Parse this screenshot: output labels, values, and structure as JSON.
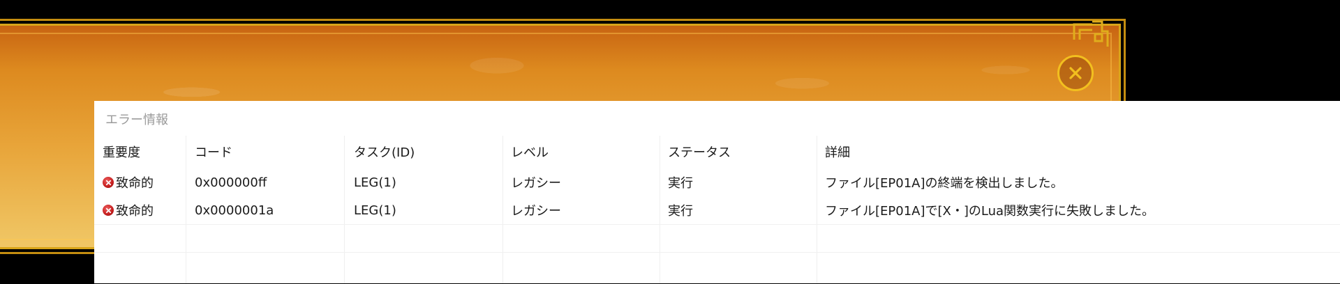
{
  "panel": {
    "title": "エラー情報"
  },
  "columns": [
    "重要度",
    "コード",
    "タスク(ID)",
    "レベル",
    "ステータス",
    "詳細"
  ],
  "rows": [
    {
      "severity": "致命的",
      "severity_icon": "error-x-icon",
      "code": "0x000000ff",
      "task": "LEG(1)",
      "level": "レガシー",
      "status": "実行",
      "detail": "ファイル[EP01A]の終端を検出しました。"
    },
    {
      "severity": "致命的",
      "severity_icon": "error-x-icon",
      "code": "0x0000001a",
      "task": "LEG(1)",
      "level": "レガシー",
      "status": "実行",
      "detail": "ファイル[EP01A]で[X・]のLua関数実行に失敗しました。"
    }
  ],
  "colors": {
    "frame_gold": "#d9a51a",
    "background_orange": "#dd8a1f",
    "error_red": "#c41e1e"
  },
  "icons": {
    "close": "close-circle-icon",
    "ornament": "corner-ornament-icon"
  }
}
